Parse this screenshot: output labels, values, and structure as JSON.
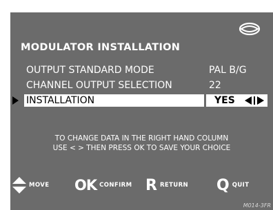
{
  "title": "MODULATOR INSTALLATION",
  "menu": [
    {
      "label": "OUTPUT STANDARD MODE",
      "value": "PAL B/G",
      "selected": false
    },
    {
      "label": "CHANNEL OUTPUT SELECTION",
      "value": "22",
      "selected": false
    },
    {
      "label": "INSTALLATION",
      "value": "YES",
      "selected": true
    }
  ],
  "help": {
    "line1": "TO CHANGE DATA IN THE RIGHT HAND COLUMN",
    "line2": "USE < > THEN PRESS OK TO SAVE YOUR CHOICE"
  },
  "legend": {
    "move": "MOVE",
    "ok_key": "OK",
    "confirm": "CONFIRM",
    "r_key": "R",
    "return": "RETURN",
    "q_key": "Q",
    "quit": "QUIT"
  },
  "reference": "M014-3FR",
  "icons": [
    "brand-logo-icon",
    "selection-pointer-icon",
    "left-right-arrows-icon",
    "up-down-arrows-icon"
  ],
  "colors": {
    "panel": "#6b6b6b",
    "text": "#ffffff",
    "highlight": "#ffffff",
    "highlight_text": "#000000"
  }
}
